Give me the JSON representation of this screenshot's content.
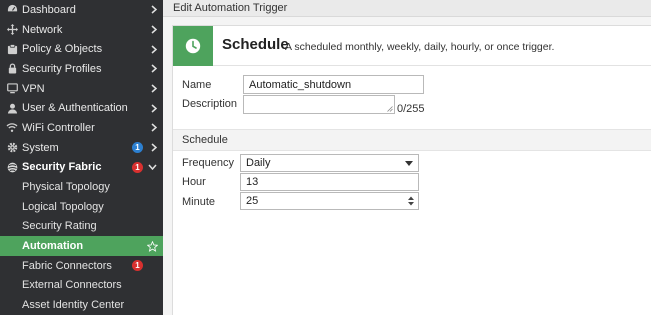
{
  "sidebar": {
    "items": [
      {
        "label": "Dashboard",
        "icon": "dashboard-icon"
      },
      {
        "label": "Network",
        "icon": "network-icon"
      },
      {
        "label": "Policy & Objects",
        "icon": "policy-icon"
      },
      {
        "label": "Security Profiles",
        "icon": "lock-icon"
      },
      {
        "label": "VPN",
        "icon": "monitor-icon"
      },
      {
        "label": "User & Authentication",
        "icon": "user-icon"
      },
      {
        "label": "WiFi Controller",
        "icon": "wifi-icon"
      },
      {
        "label": "System",
        "icon": "gear-icon",
        "badge": "1",
        "badge_color": "#2c7fd0"
      },
      {
        "label": "Security Fabric",
        "icon": "fabric-icon",
        "badge": "1",
        "badge_color": "#d8302f"
      }
    ],
    "sub_items": [
      {
        "label": "Physical Topology"
      },
      {
        "label": "Logical Topology"
      },
      {
        "label": "Security Rating"
      },
      {
        "label": "Automation",
        "active": true
      },
      {
        "label": "Fabric Connectors",
        "badge": "1"
      },
      {
        "label": "External Connectors"
      },
      {
        "label": "Asset Identity Center"
      }
    ]
  },
  "header": {
    "title": "Edit Automation Trigger"
  },
  "trigger": {
    "title": "Schedule",
    "description": "A scheduled monthly, weekly, daily, hourly, or once trigger.",
    "icon": "clock-icon"
  },
  "form": {
    "name_label": "Name",
    "name_value": "Automatic_shutdown",
    "description_label": "Description",
    "description_value": "",
    "description_counter": "0/255",
    "schedule_section": "Schedule",
    "frequency_label": "Frequency",
    "frequency_value": "Daily",
    "hour_label": "Hour",
    "hour_value": "13",
    "minute_label": "Minute",
    "minute_value": "25"
  },
  "colors": {
    "sidebar_bg": "#2f3033",
    "accent_green": "#4ea35d",
    "badge_blue": "#2c7fd0",
    "badge_red": "#d8302f"
  }
}
